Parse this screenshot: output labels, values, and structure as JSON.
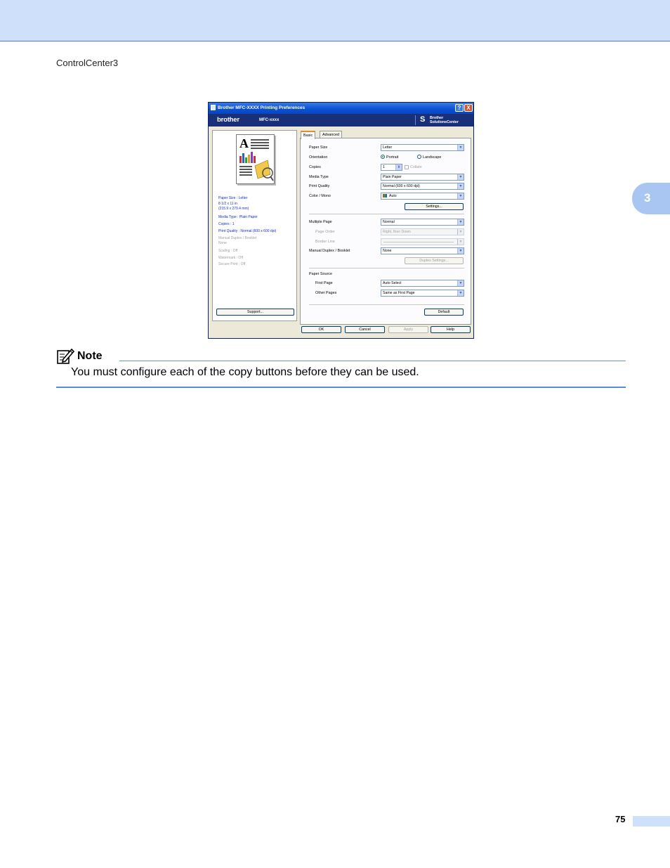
{
  "header": {
    "running_title": "ControlCenter3",
    "chapter_number": "3",
    "page_number": "75"
  },
  "dialog": {
    "title": "Brother MFC-XXXX Printing Preferences",
    "help_button": "?",
    "close_button": "X",
    "brand": "brother",
    "model": "MFC-xxxx",
    "solutions_center": [
      "Brother",
      "SolutionsCenter"
    ],
    "summary": [
      "Paper Size : Letter",
      "8 1/2 x 11 in",
      "(215.9 x 279.4 mm)",
      "Media Type : Plain Paper",
      "Copies : 1",
      "Print Quality : Normal (600 x 600 dpi)"
    ],
    "summary_disabled": [
      "Manual Duplex / Booklet",
      "None",
      "Scaling : Off",
      "Watermark : Off",
      "Secure Print : Off"
    ],
    "support_button": "Support...",
    "tabs": [
      "Basic",
      "Advanced"
    ],
    "basic": {
      "paper_size": {
        "label": "Paper Size",
        "value": "Letter"
      },
      "orientation": {
        "label": "Orientation",
        "options": [
          "Portrait",
          "Landscape"
        ],
        "selected": "Portrait"
      },
      "copies": {
        "label": "Copies",
        "value": "1",
        "collate_label": "Collate"
      },
      "media_type": {
        "label": "Media Type",
        "value": "Plain Paper"
      },
      "print_quality": {
        "label": "Print Quality",
        "value": "Normal (600 x 600 dpi)"
      },
      "color_mono": {
        "label": "Color / Mono",
        "value": "Auto"
      },
      "settings_button": "Settings...",
      "multiple_page": {
        "label": "Multiple Page",
        "value": "Normal"
      },
      "page_order": {
        "label": "Page Order",
        "value": "Right, then Down"
      },
      "border_line": {
        "label": "Border Line",
        "value": ""
      },
      "manual_duplex": {
        "label": "Manual Duplex / Booklet",
        "value": "None"
      },
      "duplex_settings_button": "Duplex Settings...",
      "paper_source_heading": "Paper Source",
      "first_page": {
        "label": "First Page",
        "value": "Auto Select"
      },
      "other_pages": {
        "label": "Other Pages",
        "value": "Same as First Page"
      },
      "default_button": "Default"
    },
    "buttons": {
      "ok": "OK",
      "cancel": "Cancel",
      "apply": "Apply",
      "help": "Help"
    }
  },
  "note": {
    "label": "Note",
    "text": "You must configure each of the copy buttons before they can be used."
  }
}
